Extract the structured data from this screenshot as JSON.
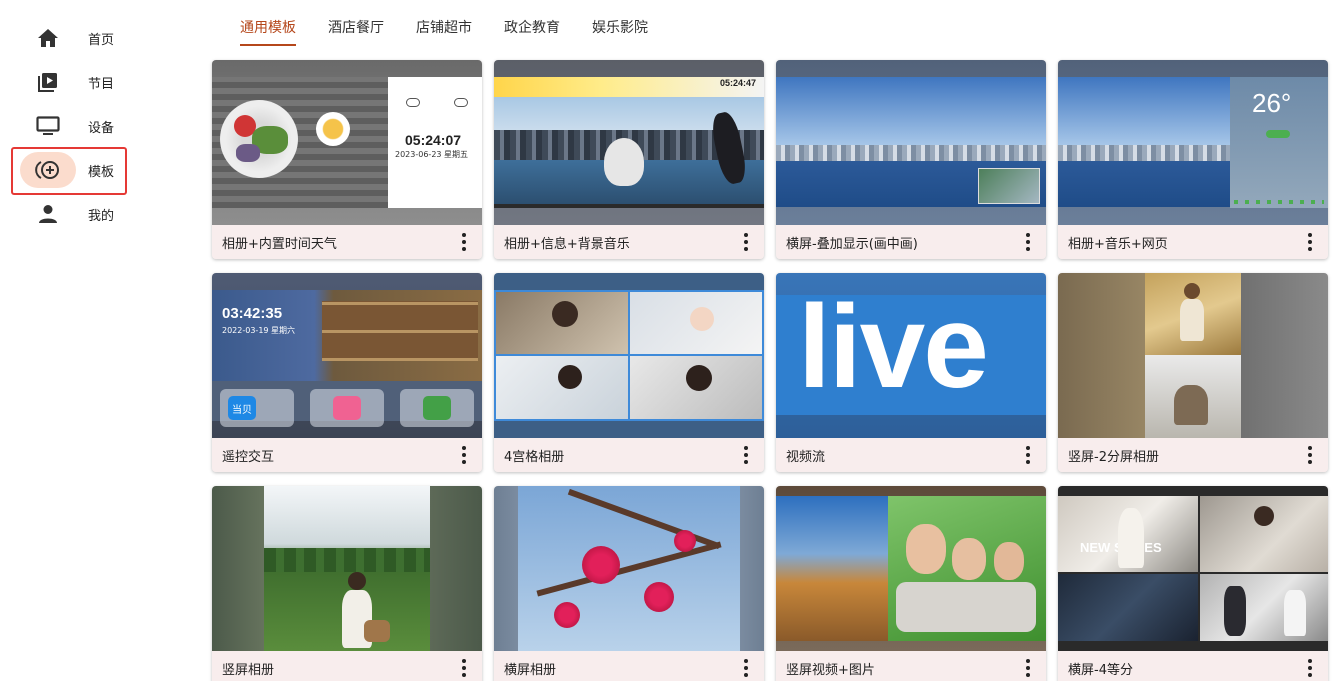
{
  "sidebar": {
    "items": [
      {
        "label": "首页",
        "icon": "home-icon"
      },
      {
        "label": "节目",
        "icon": "playlist-icon"
      },
      {
        "label": "设备",
        "icon": "monitor-icon"
      },
      {
        "label": "模板",
        "icon": "add-template-icon"
      },
      {
        "label": "我的",
        "icon": "person-icon"
      }
    ],
    "active_index": 3
  },
  "tabs": [
    {
      "label": "通用模板",
      "active": true
    },
    {
      "label": "酒店餐厅",
      "active": false
    },
    {
      "label": "店铺超市",
      "active": false
    },
    {
      "label": "政企教育",
      "active": false
    },
    {
      "label": "娱乐影院",
      "active": false
    }
  ],
  "templates": [
    {
      "title": "相册+内置时间天气",
      "thumb_text": {
        "time": "05:24:07",
        "date": "2023-06-23 星期五"
      }
    },
    {
      "title": "相册+信息+背景音乐",
      "thumb_text": {
        "time": "05:24:47"
      }
    },
    {
      "title": "横屏-叠加显示(画中画)"
    },
    {
      "title": "相册+音乐+网页",
      "thumb_text": {
        "temp": "26°"
      }
    },
    {
      "title": "遥控交互",
      "thumb_text": {
        "time": "03:42:35",
        "date": "2022-03-19 星期六",
        "app": "当贝"
      }
    },
    {
      "title": "4宫格相册"
    },
    {
      "title": "视频流",
      "thumb_text": {
        "word": "live"
      }
    },
    {
      "title": "竖屏-2分屏相册"
    },
    {
      "title": "竖屏相册"
    },
    {
      "title": "横屏相册"
    },
    {
      "title": "竖屏视频+图片"
    },
    {
      "title": "横屏-4等分",
      "thumb_text": {
        "series": "NEW SERIES"
      }
    }
  ],
  "colors": {
    "accent": "#b5471b",
    "active_nav_bg": "#fbdccd",
    "highlight_border": "#e53935",
    "card_footer": "#f8eded"
  }
}
